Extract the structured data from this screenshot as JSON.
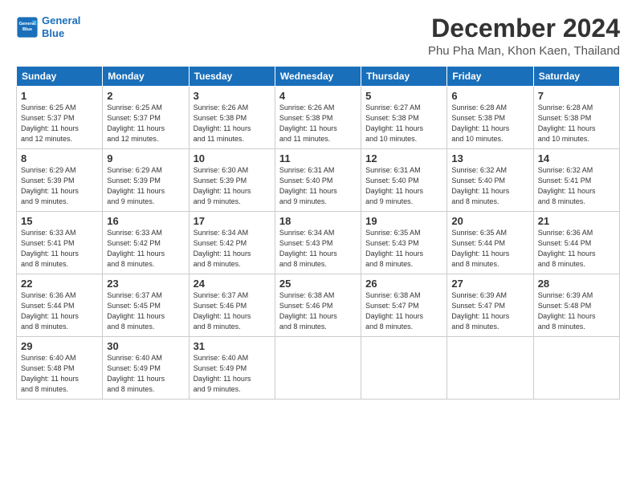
{
  "logo": {
    "line1": "General",
    "line2": "Blue"
  },
  "title": "December 2024",
  "subtitle": "Phu Pha Man, Khon Kaen, Thailand",
  "days_of_week": [
    "Sunday",
    "Monday",
    "Tuesday",
    "Wednesday",
    "Thursday",
    "Friday",
    "Saturday"
  ],
  "weeks": [
    [
      {
        "day": 1,
        "info": "Sunrise: 6:25 AM\nSunset: 5:37 PM\nDaylight: 11 hours\nand 12 minutes."
      },
      {
        "day": 2,
        "info": "Sunrise: 6:25 AM\nSunset: 5:37 PM\nDaylight: 11 hours\nand 12 minutes."
      },
      {
        "day": 3,
        "info": "Sunrise: 6:26 AM\nSunset: 5:38 PM\nDaylight: 11 hours\nand 11 minutes."
      },
      {
        "day": 4,
        "info": "Sunrise: 6:26 AM\nSunset: 5:38 PM\nDaylight: 11 hours\nand 11 minutes."
      },
      {
        "day": 5,
        "info": "Sunrise: 6:27 AM\nSunset: 5:38 PM\nDaylight: 11 hours\nand 10 minutes."
      },
      {
        "day": 6,
        "info": "Sunrise: 6:28 AM\nSunset: 5:38 PM\nDaylight: 11 hours\nand 10 minutes."
      },
      {
        "day": 7,
        "info": "Sunrise: 6:28 AM\nSunset: 5:38 PM\nDaylight: 11 hours\nand 10 minutes."
      }
    ],
    [
      {
        "day": 8,
        "info": "Sunrise: 6:29 AM\nSunset: 5:39 PM\nDaylight: 11 hours\nand 9 minutes."
      },
      {
        "day": 9,
        "info": "Sunrise: 6:29 AM\nSunset: 5:39 PM\nDaylight: 11 hours\nand 9 minutes."
      },
      {
        "day": 10,
        "info": "Sunrise: 6:30 AM\nSunset: 5:39 PM\nDaylight: 11 hours\nand 9 minutes."
      },
      {
        "day": 11,
        "info": "Sunrise: 6:31 AM\nSunset: 5:40 PM\nDaylight: 11 hours\nand 9 minutes."
      },
      {
        "day": 12,
        "info": "Sunrise: 6:31 AM\nSunset: 5:40 PM\nDaylight: 11 hours\nand 9 minutes."
      },
      {
        "day": 13,
        "info": "Sunrise: 6:32 AM\nSunset: 5:40 PM\nDaylight: 11 hours\nand 8 minutes."
      },
      {
        "day": 14,
        "info": "Sunrise: 6:32 AM\nSunset: 5:41 PM\nDaylight: 11 hours\nand 8 minutes."
      }
    ],
    [
      {
        "day": 15,
        "info": "Sunrise: 6:33 AM\nSunset: 5:41 PM\nDaylight: 11 hours\nand 8 minutes."
      },
      {
        "day": 16,
        "info": "Sunrise: 6:33 AM\nSunset: 5:42 PM\nDaylight: 11 hours\nand 8 minutes."
      },
      {
        "day": 17,
        "info": "Sunrise: 6:34 AM\nSunset: 5:42 PM\nDaylight: 11 hours\nand 8 minutes."
      },
      {
        "day": 18,
        "info": "Sunrise: 6:34 AM\nSunset: 5:43 PM\nDaylight: 11 hours\nand 8 minutes."
      },
      {
        "day": 19,
        "info": "Sunrise: 6:35 AM\nSunset: 5:43 PM\nDaylight: 11 hours\nand 8 minutes."
      },
      {
        "day": 20,
        "info": "Sunrise: 6:35 AM\nSunset: 5:44 PM\nDaylight: 11 hours\nand 8 minutes."
      },
      {
        "day": 21,
        "info": "Sunrise: 6:36 AM\nSunset: 5:44 PM\nDaylight: 11 hours\nand 8 minutes."
      }
    ],
    [
      {
        "day": 22,
        "info": "Sunrise: 6:36 AM\nSunset: 5:44 PM\nDaylight: 11 hours\nand 8 minutes."
      },
      {
        "day": 23,
        "info": "Sunrise: 6:37 AM\nSunset: 5:45 PM\nDaylight: 11 hours\nand 8 minutes."
      },
      {
        "day": 24,
        "info": "Sunrise: 6:37 AM\nSunset: 5:46 PM\nDaylight: 11 hours\nand 8 minutes."
      },
      {
        "day": 25,
        "info": "Sunrise: 6:38 AM\nSunset: 5:46 PM\nDaylight: 11 hours\nand 8 minutes."
      },
      {
        "day": 26,
        "info": "Sunrise: 6:38 AM\nSunset: 5:47 PM\nDaylight: 11 hours\nand 8 minutes."
      },
      {
        "day": 27,
        "info": "Sunrise: 6:39 AM\nSunset: 5:47 PM\nDaylight: 11 hours\nand 8 minutes."
      },
      {
        "day": 28,
        "info": "Sunrise: 6:39 AM\nSunset: 5:48 PM\nDaylight: 11 hours\nand 8 minutes."
      }
    ],
    [
      {
        "day": 29,
        "info": "Sunrise: 6:40 AM\nSunset: 5:48 PM\nDaylight: 11 hours\nand 8 minutes."
      },
      {
        "day": 30,
        "info": "Sunrise: 6:40 AM\nSunset: 5:49 PM\nDaylight: 11 hours\nand 8 minutes."
      },
      {
        "day": 31,
        "info": "Sunrise: 6:40 AM\nSunset: 5:49 PM\nDaylight: 11 hours\nand 9 minutes."
      },
      {
        "day": null,
        "info": ""
      },
      {
        "day": null,
        "info": ""
      },
      {
        "day": null,
        "info": ""
      },
      {
        "day": null,
        "info": ""
      }
    ]
  ]
}
